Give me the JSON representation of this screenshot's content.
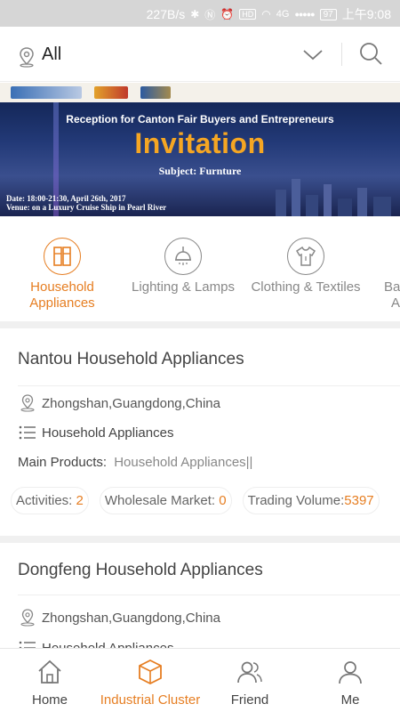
{
  "status_bar": {
    "speed": "227B/s",
    "network": "4G",
    "signal": "●●●●●",
    "battery": "97",
    "time": "上午9:08"
  },
  "header": {
    "location": "All"
  },
  "banner": {
    "subtitle": "Reception for Canton Fair Buyers and Entrepreneurs",
    "title": "Invitation",
    "subject": "Subject: Furnture",
    "date": "Date: 18:00-21:30, April 26th, 2017",
    "venue": "Venue: on a Luxury Cruise Ship in Pearl River"
  },
  "categories": [
    {
      "line1": "Household",
      "line2": "Appliances",
      "icon": "household-appliances-icon",
      "active": true
    },
    {
      "line1": "Lighting & Lamps",
      "line2": "",
      "icon": "lamp-icon",
      "active": false
    },
    {
      "line1": "Clothing & Textiles",
      "line2": "",
      "icon": "tshirt-icon",
      "active": false
    },
    {
      "line1": "Ba",
      "line2": "A",
      "icon": "",
      "active": false
    }
  ],
  "cards": [
    {
      "title": "Nantou Household Appliances",
      "location": "Zhongshan,Guangdong,China",
      "category": "Household Appliances",
      "main_products_label": "Main Products:",
      "main_products": "Household Appliances||",
      "activities_label": "Activities:",
      "activities": "2",
      "wholesale_label": "Wholesale Market:",
      "wholesale": "0",
      "trading_label": "Trading  Volume:",
      "trading": "5397"
    },
    {
      "title": "Dongfeng Household Appliances",
      "location": "Zhongshan,Guangdong,China",
      "category": "Household Appliances"
    }
  ],
  "nav": [
    {
      "label": "Home",
      "icon": "home-icon",
      "active": false
    },
    {
      "label": "Industrial Cluster",
      "icon": "cube-icon",
      "active": true
    },
    {
      "label": "Friend",
      "icon": "friends-icon",
      "active": false
    },
    {
      "label": "Me",
      "icon": "person-icon",
      "active": false
    }
  ],
  "colors": {
    "accent": "#e67e22",
    "banner_title": "#f5a623"
  }
}
